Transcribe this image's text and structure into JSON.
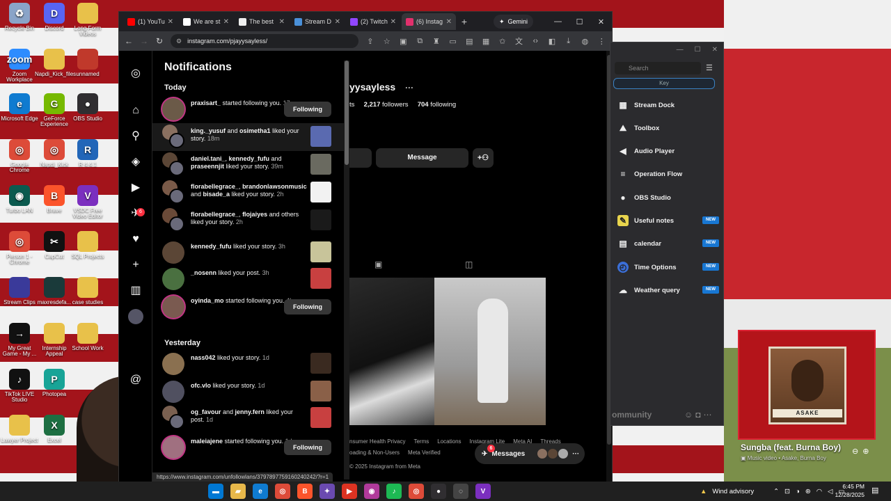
{
  "desktop": {
    "icons": [
      {
        "label": "Recycle Bin",
        "color": "#8aa4c8",
        "glyph": "♻"
      },
      {
        "label": "Discord",
        "color": "#5865f2",
        "glyph": "D"
      },
      {
        "label": "Long Form Videos",
        "color": "#e8c14a",
        "glyph": ""
      },
      {
        "label": "Zoom Workplace",
        "color": "#2d8cff",
        "glyph": "zoom"
      },
      {
        "label": "Napdi_Kick_files",
        "color": "#e8c14a",
        "glyph": ""
      },
      {
        "label": "unnamed",
        "color": "#c0392b",
        "glyph": ""
      },
      {
        "label": "Microsoft Edge",
        "color": "#0f7bd0",
        "glyph": "e"
      },
      {
        "label": "GeForce Experience",
        "color": "#76b900",
        "glyph": "G"
      },
      {
        "label": "OBS Studio",
        "color": "#302e31",
        "glyph": "●"
      },
      {
        "label": "Google Chrome",
        "color": "#dd4b39",
        "glyph": "◎"
      },
      {
        "label": "Napdi_Kick",
        "color": "#dd4b39",
        "glyph": "◎"
      },
      {
        "label": "R 4.4.1",
        "color": "#2266b8",
        "glyph": "R"
      },
      {
        "label": "Turbo LAN",
        "color": "#0b5a4f",
        "glyph": "◉"
      },
      {
        "label": "Brave",
        "color": "#fb542b",
        "glyph": "B"
      },
      {
        "label": "VSDC Free Video Editor",
        "color": "#7b2fbf",
        "glyph": "V"
      },
      {
        "label": "Person 1 - Chrome",
        "color": "#dd4b39",
        "glyph": "◎"
      },
      {
        "label": "CapCut",
        "color": "#111111",
        "glyph": "✂"
      },
      {
        "label": "SQL Projects",
        "color": "#e8c14a",
        "glyph": ""
      },
      {
        "label": "Stream Clips",
        "color": "#3a3a9a",
        "glyph": ""
      },
      {
        "label": "maxresdefa...",
        "color": "#1a3a3a",
        "glyph": ""
      },
      {
        "label": "case studies",
        "color": "#e8c14a",
        "glyph": ""
      },
      {
        "label": "My Great Game - My ...",
        "color": "#111111",
        "glyph": "→"
      },
      {
        "label": "Internship Appeal",
        "color": "#e8c14a",
        "glyph": ""
      },
      {
        "label": "School Work",
        "color": "#e8c14a",
        "glyph": ""
      },
      {
        "label": "TikTok LIVE Studio",
        "color": "#111111",
        "glyph": "♪"
      },
      {
        "label": "Photopea",
        "color": "#18a497",
        "glyph": "P"
      },
      {
        "label": "Lawyer Project",
        "color": "#e8c14a",
        "glyph": ""
      },
      {
        "label": "Excel",
        "color": "#1d6f42",
        "glyph": "X"
      }
    ]
  },
  "browser": {
    "tabs": [
      {
        "label": "(1) YouTube",
        "color": "#ff0000"
      },
      {
        "label": "We are st",
        "color": "#ffffff"
      },
      {
        "label": "The best",
        "color": "#eeeeee"
      },
      {
        "label": "Stream D",
        "color": "#4a90d9"
      },
      {
        "label": "(2) Twitch",
        "color": "#9146ff"
      },
      {
        "label": "(6) Instag",
        "color": "#e1306c"
      }
    ],
    "gemini_label": "Gemini",
    "url": "instagram.com/pjayysayless/",
    "status_url": "https://www.instagram.com/unfollowlans/3797897759160240242/?r=1"
  },
  "notifications": {
    "title": "Notifications",
    "today_label": "Today",
    "yesterday_label": "Yesterday",
    "today": [
      {
        "users": "praxisart_",
        "action": " started following you.",
        "time": "17m",
        "button": "Following",
        "avatar": "#6b5a48"
      },
      {
        "users": "king._yusuf",
        "mid": " and ",
        "users2": "osimetha1",
        "action": " liked your story.",
        "time": "18m",
        "thumb": "#5a6ab0",
        "avatar": "#8a7060"
      },
      {
        "users": "daniel.tani_",
        "mid": ", ",
        "users2": "kennedy_fufu",
        "mid2": " and ",
        "users3": "praseennjit",
        "action": " liked your story.",
        "time": "39m",
        "thumb": "#6a6a60",
        "avatar": "#5b4636"
      },
      {
        "users": "florabellegrace_",
        "mid": ", ",
        "users2": "brandonlawsonmusic",
        "mid2": " and ",
        "users3": "bisade_a",
        "action": " liked your story.",
        "time": "2h",
        "thumb": "#f2f2f2",
        "avatar": "#7a5a48"
      },
      {
        "users": "florabellegrace_",
        "mid": ", ",
        "users2": "flojaiyes",
        "action": " and others liked your story.",
        "time": "2h",
        "thumb": "#1a1a1a",
        "avatar": "#6a4a38"
      },
      {
        "users": "kennedy_fufu",
        "action": " liked your story.",
        "time": "3h",
        "thumb": "#c8c49a",
        "avatar": "#5b4636"
      },
      {
        "users": "_nosenn",
        "action": " liked your post.",
        "time": "3h",
        "thumb": "#c84040",
        "avatar": "#4a7040"
      },
      {
        "users": "oyinda_mo",
        "action": " started following you.",
        "time": "4h",
        "button": "Following",
        "avatar": "#7a5a50"
      }
    ],
    "yesterday": [
      {
        "users": "nass042",
        "action": " liked your story.",
        "time": "1d",
        "thumb": "#3a2a20",
        "avatar": "#8a7050"
      },
      {
        "users": "ofc.vlo",
        "action": " liked your story.",
        "time": "1d",
        "thumb": "#8a6048",
        "avatar": "#505060"
      },
      {
        "users": "og_favour",
        "mid": " and ",
        "users2": "jenny.fern",
        "action": " liked your post.",
        "time": "1d",
        "thumb": "#c84040",
        "avatar": "#7a6050"
      },
      {
        "users": "maleiajene",
        "action": " started following you.",
        "time": "1d",
        "button": "Following",
        "avatar": "#a07080"
      }
    ],
    "rail_badge": "6"
  },
  "profile": {
    "name_visible": "yysayless",
    "more": "···",
    "posts_suffix": "ts",
    "followers": "2,217",
    "followers_label": " followers",
    "following": "704",
    "following_label": " following",
    "message_btn": "Message",
    "footer_row1": [
      "nsumer Health Privacy",
      "Terms",
      "Locations",
      "Instagram Lite",
      "Meta AI",
      "Threads"
    ],
    "footer_row2": [
      "oading & Non-Users",
      "Meta Verified"
    ],
    "copyright": "© 2025 Instagram from Meta",
    "messages_label": "Messages",
    "messages_badge": "6"
  },
  "streamdock": {
    "search_placeholder": "Search",
    "key_label": "Key",
    "items": [
      {
        "label": "Stream Dock",
        "icon": "▦",
        "new": ""
      },
      {
        "label": "Toolbox",
        "icon": "⛰",
        "new": ""
      },
      {
        "label": "Audio Player",
        "icon": "◀",
        "new": ""
      },
      {
        "label": "Operation Flow",
        "icon": "≡",
        "new": ""
      },
      {
        "label": "OBS Studio",
        "icon": "●",
        "new": ""
      },
      {
        "label": "Useful notes",
        "icon": "✎",
        "new": "NEW"
      },
      {
        "label": "calendar",
        "icon": "▤",
        "new": "NEW"
      },
      {
        "label": "Time Options",
        "icon": "◴",
        "new": "NEW"
      },
      {
        "label": "Weather query",
        "icon": "☁",
        "new": "NEW"
      }
    ],
    "community_label": "ommunity"
  },
  "music": {
    "title": "Sungba (feat. Burna Boy)",
    "subtitle": "Music video • Asake, Burna Boy",
    "art_label": "ASAKE"
  },
  "taskbar": {
    "weather": "Wind advisory",
    "time": "6:45 PM",
    "date": "12/28/2025"
  }
}
